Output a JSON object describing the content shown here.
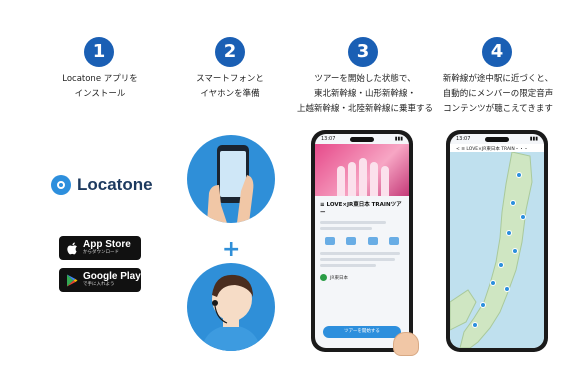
{
  "steps": [
    {
      "number": "1",
      "line1": "Locatone アプリを",
      "line2": "インストール",
      "line3": ""
    },
    {
      "number": "2",
      "line1": "スマートフォンと",
      "line2": "イヤホンを準備",
      "line3": ""
    },
    {
      "number": "3",
      "line1": "ツアーを開始した状態で、",
      "line2": "東北新幹線・山形新幹線・",
      "line3": "上越新幹線・北陸新幹線に乗車する"
    },
    {
      "number": "4",
      "line1": "新幹線が途中駅に近づくと、",
      "line2": "自動的にメンバーの限定音声",
      "line3": "コンテンツが聴こえてきます"
    }
  ],
  "brand": {
    "name": "Locatone"
  },
  "app_store": {
    "title": "App Store",
    "subtitle": "からダウンロード"
  },
  "google_play": {
    "title": "Google Play",
    "subtitle": "で手に入れよう"
  },
  "plus": "+",
  "phone3": {
    "time": "13:07",
    "tour_title": "≡ LOVE×JR東日本 TRAINツアー",
    "operator": "JR東日本",
    "cta": "ツアーを開始する"
  },
  "phone4": {
    "time": "13:07",
    "header": "< ≡ LOVE×JR東日本 TRAIN・・・"
  },
  "colors": {
    "accent": "#1a5fb4",
    "brand_blue": "#2d8fdd",
    "pink": "#e64a8a"
  }
}
